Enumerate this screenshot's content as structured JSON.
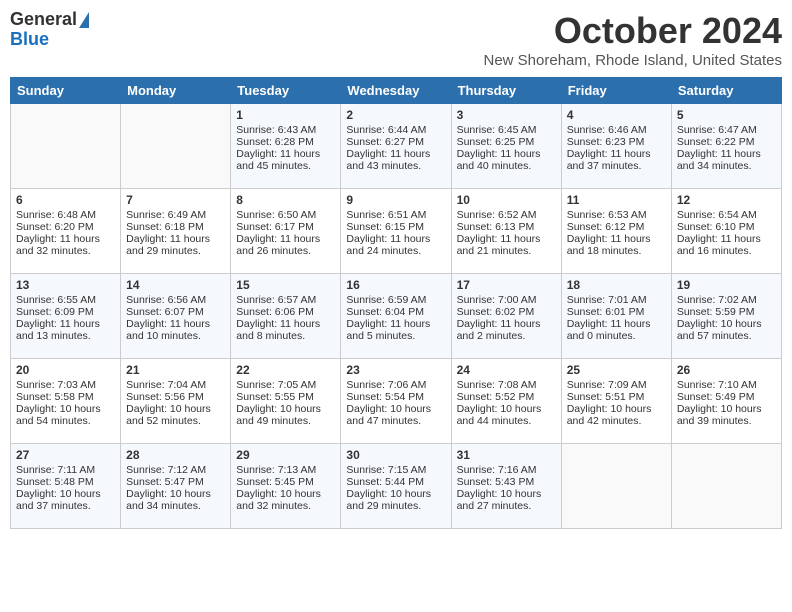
{
  "header": {
    "logo_general": "General",
    "logo_blue": "Blue",
    "month_title": "October 2024",
    "location": "New Shoreham, Rhode Island, United States"
  },
  "days_of_week": [
    "Sunday",
    "Monday",
    "Tuesday",
    "Wednesday",
    "Thursday",
    "Friday",
    "Saturday"
  ],
  "weeks": [
    [
      {
        "day": "",
        "sunrise": "",
        "sunset": "",
        "daylight": ""
      },
      {
        "day": "",
        "sunrise": "",
        "sunset": "",
        "daylight": ""
      },
      {
        "day": "1",
        "sunrise": "Sunrise: 6:43 AM",
        "sunset": "Sunset: 6:28 PM",
        "daylight": "Daylight: 11 hours and 45 minutes."
      },
      {
        "day": "2",
        "sunrise": "Sunrise: 6:44 AM",
        "sunset": "Sunset: 6:27 PM",
        "daylight": "Daylight: 11 hours and 43 minutes."
      },
      {
        "day": "3",
        "sunrise": "Sunrise: 6:45 AM",
        "sunset": "Sunset: 6:25 PM",
        "daylight": "Daylight: 11 hours and 40 minutes."
      },
      {
        "day": "4",
        "sunrise": "Sunrise: 6:46 AM",
        "sunset": "Sunset: 6:23 PM",
        "daylight": "Daylight: 11 hours and 37 minutes."
      },
      {
        "day": "5",
        "sunrise": "Sunrise: 6:47 AM",
        "sunset": "Sunset: 6:22 PM",
        "daylight": "Daylight: 11 hours and 34 minutes."
      }
    ],
    [
      {
        "day": "6",
        "sunrise": "Sunrise: 6:48 AM",
        "sunset": "Sunset: 6:20 PM",
        "daylight": "Daylight: 11 hours and 32 minutes."
      },
      {
        "day": "7",
        "sunrise": "Sunrise: 6:49 AM",
        "sunset": "Sunset: 6:18 PM",
        "daylight": "Daylight: 11 hours and 29 minutes."
      },
      {
        "day": "8",
        "sunrise": "Sunrise: 6:50 AM",
        "sunset": "Sunset: 6:17 PM",
        "daylight": "Daylight: 11 hours and 26 minutes."
      },
      {
        "day": "9",
        "sunrise": "Sunrise: 6:51 AM",
        "sunset": "Sunset: 6:15 PM",
        "daylight": "Daylight: 11 hours and 24 minutes."
      },
      {
        "day": "10",
        "sunrise": "Sunrise: 6:52 AM",
        "sunset": "Sunset: 6:13 PM",
        "daylight": "Daylight: 11 hours and 21 minutes."
      },
      {
        "day": "11",
        "sunrise": "Sunrise: 6:53 AM",
        "sunset": "Sunset: 6:12 PM",
        "daylight": "Daylight: 11 hours and 18 minutes."
      },
      {
        "day": "12",
        "sunrise": "Sunrise: 6:54 AM",
        "sunset": "Sunset: 6:10 PM",
        "daylight": "Daylight: 11 hours and 16 minutes."
      }
    ],
    [
      {
        "day": "13",
        "sunrise": "Sunrise: 6:55 AM",
        "sunset": "Sunset: 6:09 PM",
        "daylight": "Daylight: 11 hours and 13 minutes."
      },
      {
        "day": "14",
        "sunrise": "Sunrise: 6:56 AM",
        "sunset": "Sunset: 6:07 PM",
        "daylight": "Daylight: 11 hours and 10 minutes."
      },
      {
        "day": "15",
        "sunrise": "Sunrise: 6:57 AM",
        "sunset": "Sunset: 6:06 PM",
        "daylight": "Daylight: 11 hours and 8 minutes."
      },
      {
        "day": "16",
        "sunrise": "Sunrise: 6:59 AM",
        "sunset": "Sunset: 6:04 PM",
        "daylight": "Daylight: 11 hours and 5 minutes."
      },
      {
        "day": "17",
        "sunrise": "Sunrise: 7:00 AM",
        "sunset": "Sunset: 6:02 PM",
        "daylight": "Daylight: 11 hours and 2 minutes."
      },
      {
        "day": "18",
        "sunrise": "Sunrise: 7:01 AM",
        "sunset": "Sunset: 6:01 PM",
        "daylight": "Daylight: 11 hours and 0 minutes."
      },
      {
        "day": "19",
        "sunrise": "Sunrise: 7:02 AM",
        "sunset": "Sunset: 5:59 PM",
        "daylight": "Daylight: 10 hours and 57 minutes."
      }
    ],
    [
      {
        "day": "20",
        "sunrise": "Sunrise: 7:03 AM",
        "sunset": "Sunset: 5:58 PM",
        "daylight": "Daylight: 10 hours and 54 minutes."
      },
      {
        "day": "21",
        "sunrise": "Sunrise: 7:04 AM",
        "sunset": "Sunset: 5:56 PM",
        "daylight": "Daylight: 10 hours and 52 minutes."
      },
      {
        "day": "22",
        "sunrise": "Sunrise: 7:05 AM",
        "sunset": "Sunset: 5:55 PM",
        "daylight": "Daylight: 10 hours and 49 minutes."
      },
      {
        "day": "23",
        "sunrise": "Sunrise: 7:06 AM",
        "sunset": "Sunset: 5:54 PM",
        "daylight": "Daylight: 10 hours and 47 minutes."
      },
      {
        "day": "24",
        "sunrise": "Sunrise: 7:08 AM",
        "sunset": "Sunset: 5:52 PM",
        "daylight": "Daylight: 10 hours and 44 minutes."
      },
      {
        "day": "25",
        "sunrise": "Sunrise: 7:09 AM",
        "sunset": "Sunset: 5:51 PM",
        "daylight": "Daylight: 10 hours and 42 minutes."
      },
      {
        "day": "26",
        "sunrise": "Sunrise: 7:10 AM",
        "sunset": "Sunset: 5:49 PM",
        "daylight": "Daylight: 10 hours and 39 minutes."
      }
    ],
    [
      {
        "day": "27",
        "sunrise": "Sunrise: 7:11 AM",
        "sunset": "Sunset: 5:48 PM",
        "daylight": "Daylight: 10 hours and 37 minutes."
      },
      {
        "day": "28",
        "sunrise": "Sunrise: 7:12 AM",
        "sunset": "Sunset: 5:47 PM",
        "daylight": "Daylight: 10 hours and 34 minutes."
      },
      {
        "day": "29",
        "sunrise": "Sunrise: 7:13 AM",
        "sunset": "Sunset: 5:45 PM",
        "daylight": "Daylight: 10 hours and 32 minutes."
      },
      {
        "day": "30",
        "sunrise": "Sunrise: 7:15 AM",
        "sunset": "Sunset: 5:44 PM",
        "daylight": "Daylight: 10 hours and 29 minutes."
      },
      {
        "day": "31",
        "sunrise": "Sunrise: 7:16 AM",
        "sunset": "Sunset: 5:43 PM",
        "daylight": "Daylight: 10 hours and 27 minutes."
      },
      {
        "day": "",
        "sunrise": "",
        "sunset": "",
        "daylight": ""
      },
      {
        "day": "",
        "sunrise": "",
        "sunset": "",
        "daylight": ""
      }
    ]
  ]
}
